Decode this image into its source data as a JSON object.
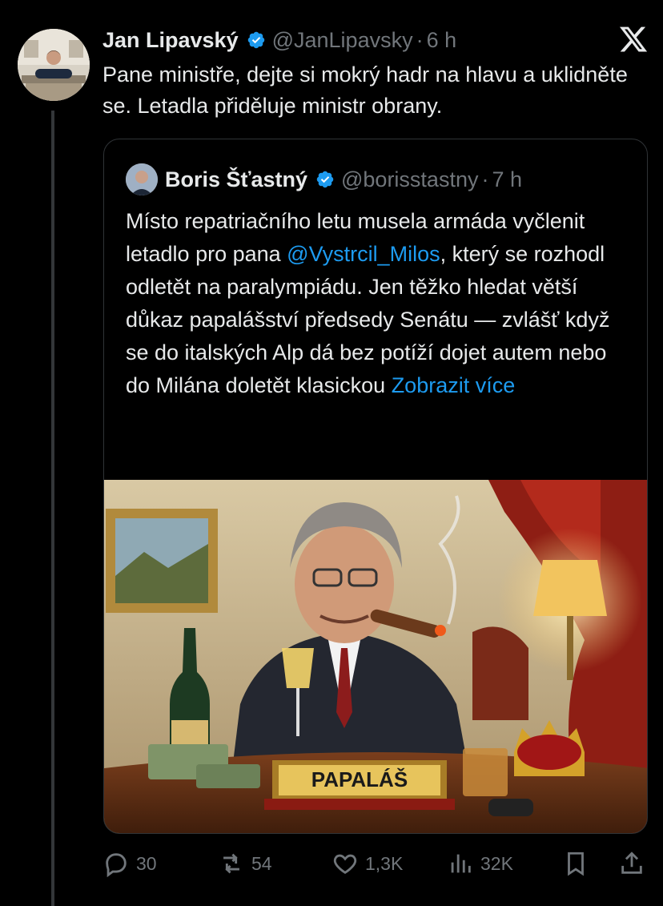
{
  "tweet": {
    "author_name": "Jan Lipavský",
    "author_handle": "@JanLipavsky",
    "separator": "·",
    "time": "6 h",
    "text": "Pane ministře, dejte si mokrý hadr na hlavu a uklidněte se. Letadla přiděluje ministr obrany."
  },
  "quoted": {
    "author_name": "Boris Šťastný",
    "author_handle": "@borisstastny",
    "separator": "·",
    "time": "7 h",
    "text_part1": "Místo repatriačního letu musela armáda vyčlenit letadlo pro pana ",
    "mention": "@Vystrcil_Milos",
    "text_part2": ", který se rozhodl odletět na paralympiádu. Jen těžko hledat větší důkaz papalášství předsedy Senátu — zvlášť když se do italských Alp dá bez potíží dojet autem nebo do Milána doletět klasickou ",
    "show_more": "Zobrazit více",
    "image_caption_sign": "PAPALÁŠ"
  },
  "actions": {
    "replies": "30",
    "reposts": "54",
    "likes": "1,3K",
    "views": "32K"
  },
  "colors": {
    "accent": "#1d9bf0",
    "muted": "#71767b",
    "text": "#e7e9ea",
    "background": "#000000"
  },
  "icons": [
    "x-logo-icon",
    "verified-badge-icon",
    "reply-icon",
    "repost-icon",
    "like-icon",
    "views-icon",
    "bookmark-icon",
    "share-icon"
  ]
}
